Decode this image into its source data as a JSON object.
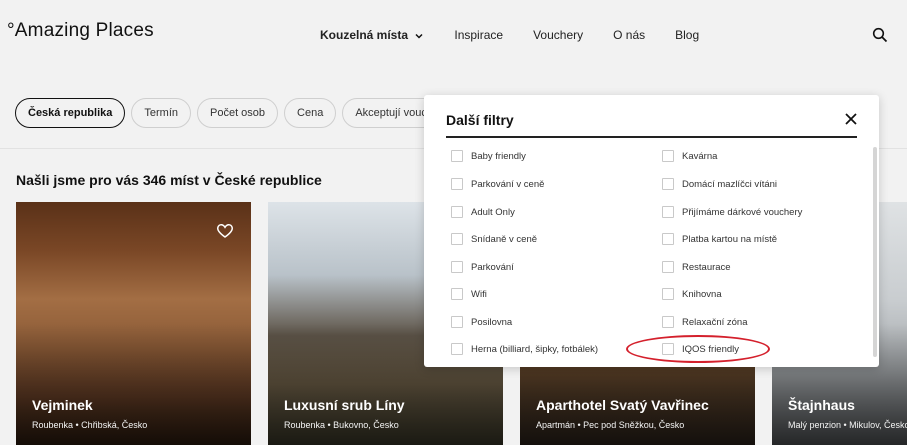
{
  "header": {
    "logo": "°Amazing Places",
    "nav": [
      {
        "label": "Kouzelná místa",
        "active": true
      },
      {
        "label": "Inspirace"
      },
      {
        "label": "Vouchery"
      },
      {
        "label": "O nás"
      },
      {
        "label": "Blog"
      }
    ],
    "search_icon": "search-icon"
  },
  "filters": {
    "chips": [
      "Česká republika",
      "Termín",
      "Počet osob",
      "Cena",
      "Akceptují vouchery"
    ]
  },
  "results": {
    "heading": "Našli jsme pro vás 346 míst v České republice",
    "cards": [
      {
        "title": "Vejminek",
        "meta": "Roubenka • Chřibská, Česko"
      },
      {
        "title": "Luxusní srub Líny",
        "meta": "Roubenka • Bukovno, Česko"
      },
      {
        "title": "Aparthotel Svatý Vavřinec",
        "meta": "Apartmán • Pec pod Sněžkou, Česko"
      },
      {
        "title": "Štajnhaus",
        "meta": "Malý penzion • Mikulov, Česko"
      }
    ]
  },
  "modal": {
    "title": "Další filtry",
    "left_options": [
      "Baby friendly",
      "Parkování v ceně",
      "Adult Only",
      "Snídaně v ceně",
      "Parkování",
      "Wifi",
      "Posilovna",
      "Herna (billiard, šipky, fotbálek)"
    ],
    "right_options": [
      "Kavárna",
      "Domácí mazlíčci vítáni",
      "Přijímáme dárkové vouchery",
      "Platba kartou na místě",
      "Restaurace",
      "Knihovna",
      "Relaxační zóna",
      "IQOS friendly"
    ]
  },
  "colors": {
    "highlight": "#d4202c",
    "background": "#f2f2f2"
  }
}
